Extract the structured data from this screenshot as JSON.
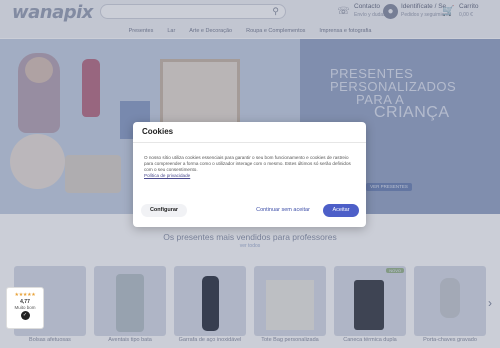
{
  "header": {
    "logo": "wanapix",
    "search_placeholder": "",
    "contact_title": "Contacto",
    "contact_sub": "Envío y dudas",
    "account_title": "Identifícate / Se",
    "account_sub": "Pedidos y seguimiento",
    "cart_title": "Carrito",
    "cart_sub": "0,00 €"
  },
  "nav": {
    "items": [
      "Presentes",
      "Lar",
      "Arte e Decoração",
      "Roupa e Complementos",
      "Imprensa e fotografia"
    ]
  },
  "hero": {
    "lines": [
      "PRESENTES",
      "PERSONALIZADOS",
      "PARA A",
      "CRIANÇA"
    ],
    "button": "VER PRESENTES"
  },
  "section": {
    "title": "Os presentes mais vendidos para professores",
    "link": "ver todos"
  },
  "products": [
    {
      "label": "Bolsas afetuosas",
      "badge": ""
    },
    {
      "label": "Aventais tipo bata",
      "badge": ""
    },
    {
      "label": "Garrafa de aço inoxidável",
      "badge": ""
    },
    {
      "label": "Tote Bag personalizada",
      "badge": ""
    },
    {
      "label": "Caneca térmica dupla",
      "badge": "NOVO"
    },
    {
      "label": "Porta-chaves gravado",
      "badge": ""
    }
  ],
  "rating": {
    "stars": "★★★★★",
    "score": "4,77",
    "text": "Muito bom"
  },
  "cookies": {
    "title": "Cookies",
    "body": "O nosso sítio utiliza cookies essenciais para garantir o seu bom funcionamento e cookies de rastreio para compreender a forma como o utilizador interage com o mesmo. Estes últimos só serão definidos com o seu consentimento.",
    "policy_link": "Política de privacidade",
    "configure_label": "Configurar",
    "continue_label": "Continuar sem aceitar",
    "accept_label": "Aceitar"
  }
}
